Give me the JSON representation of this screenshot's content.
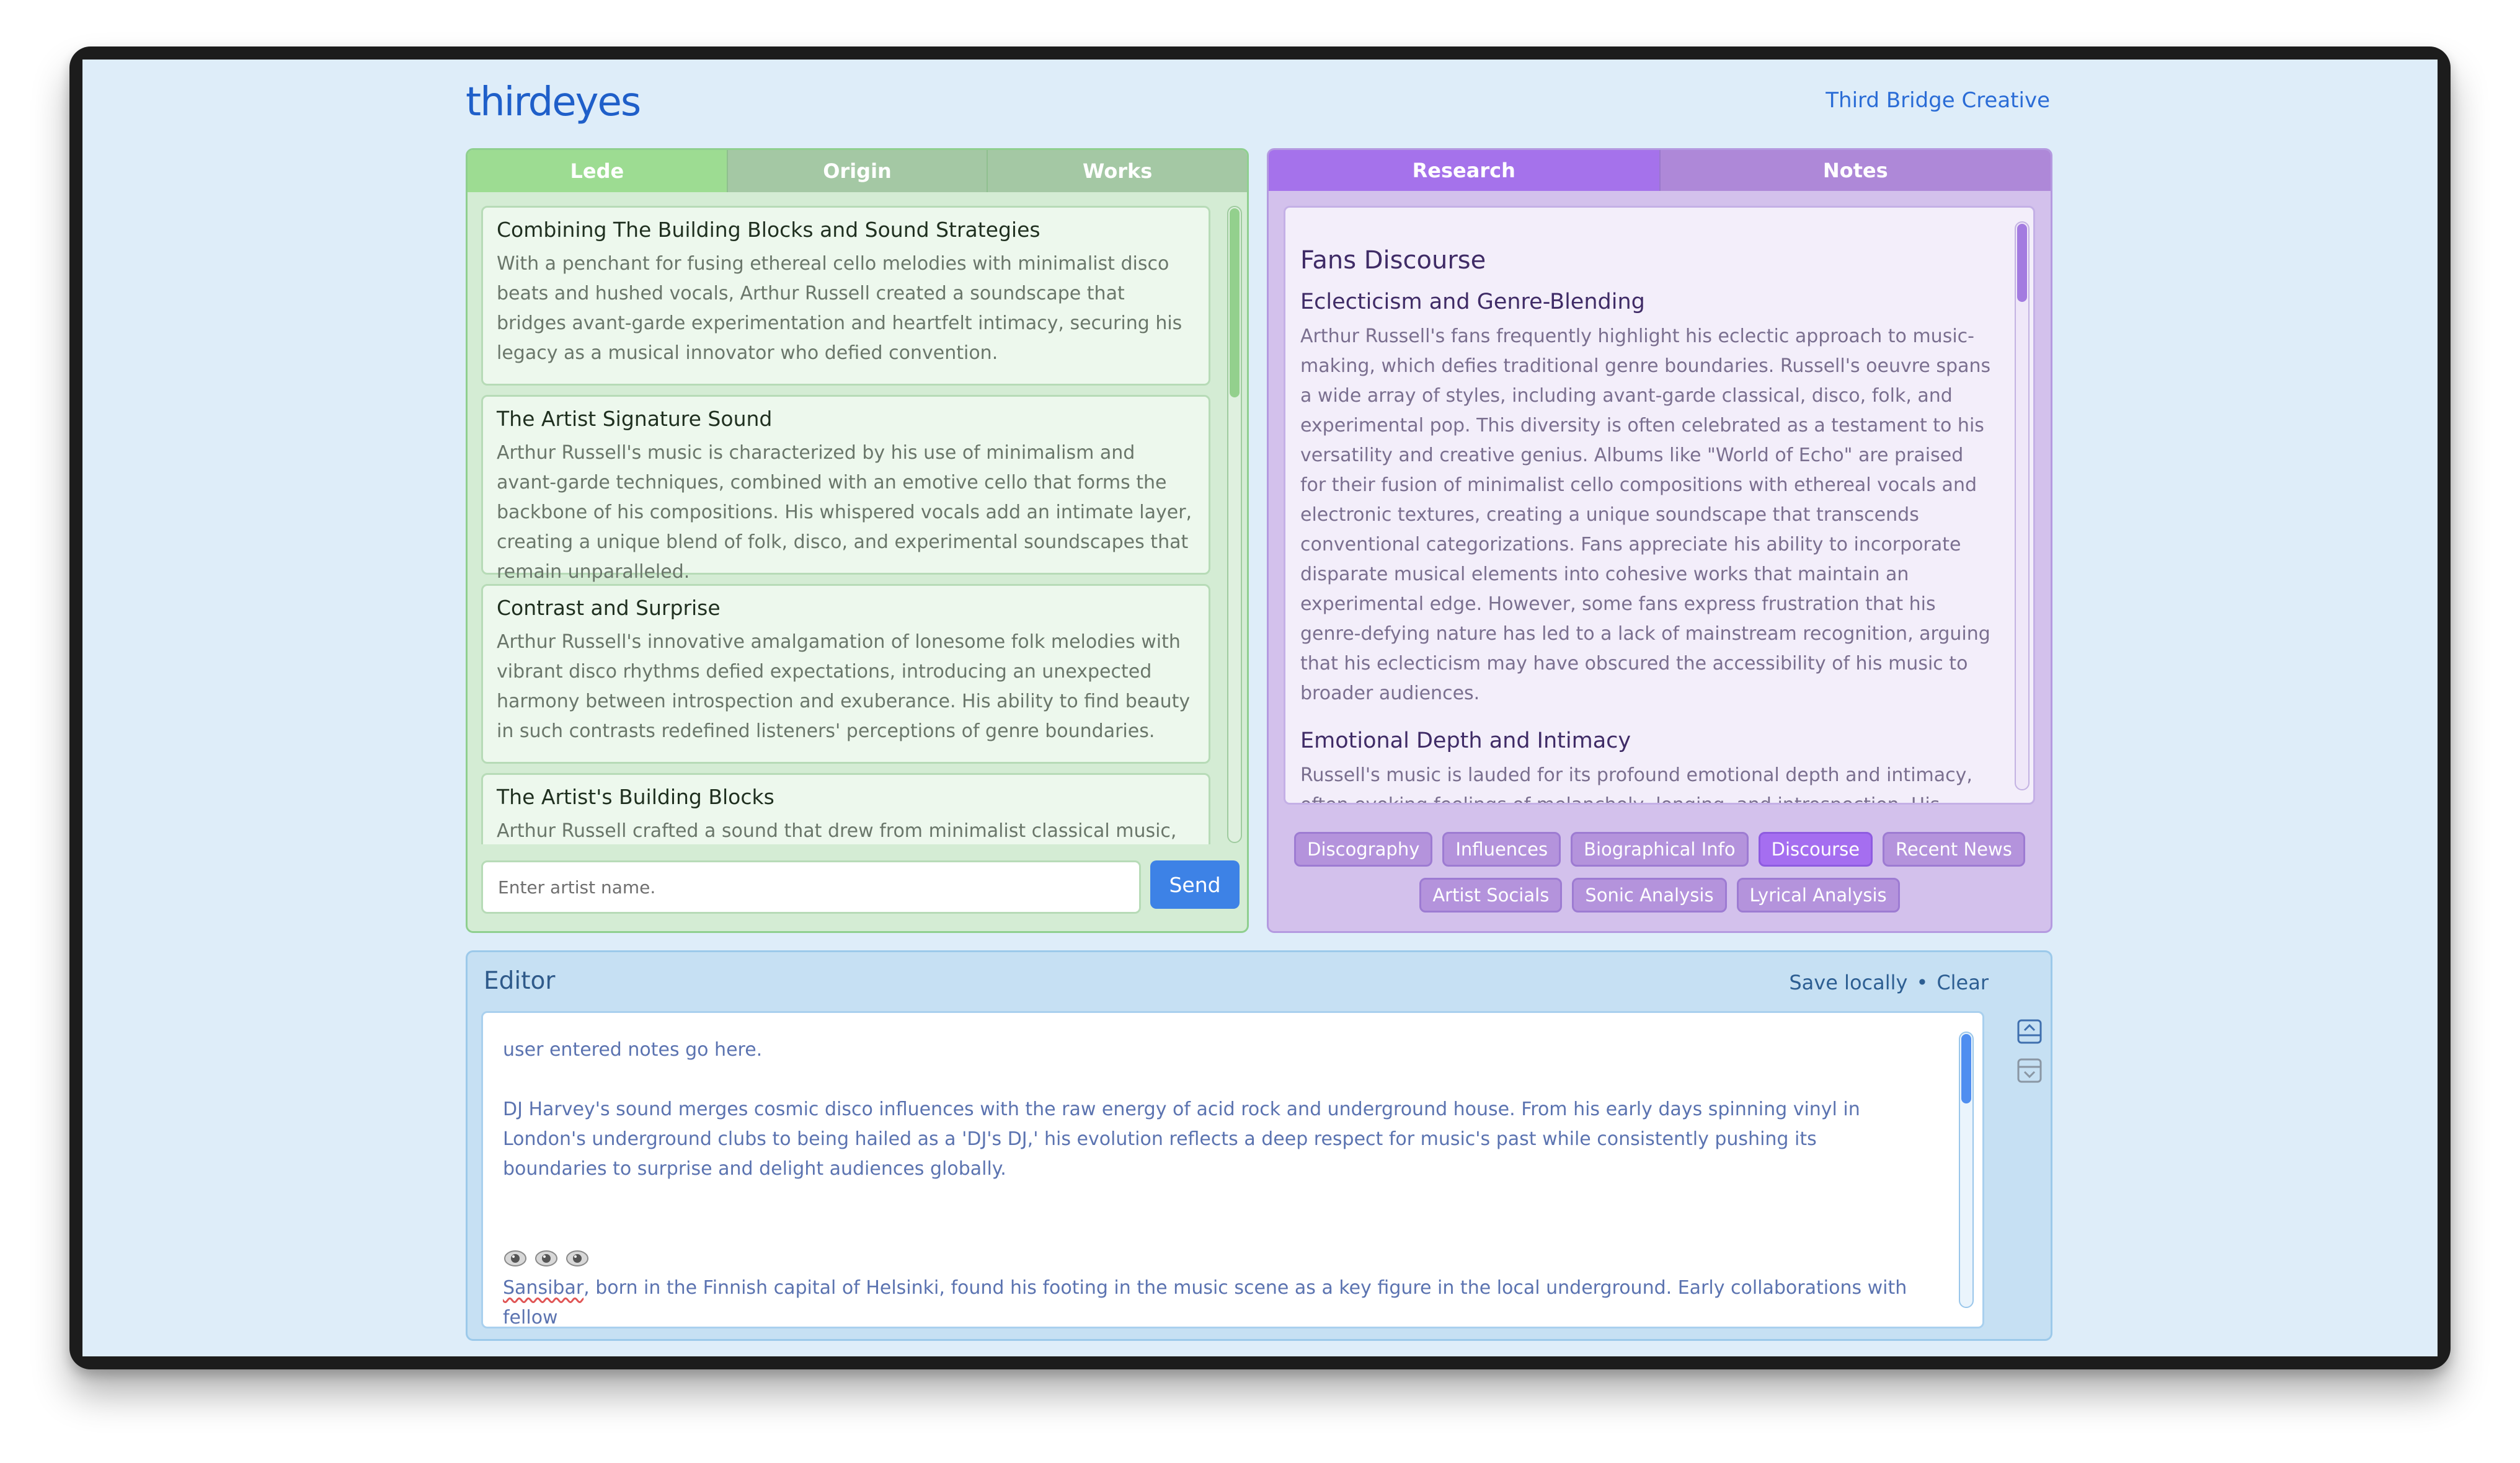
{
  "header": {
    "logo_text": "thirdeyes",
    "brand_link": "Third Bridge Creative"
  },
  "left_panel": {
    "tabs": [
      "Lede",
      "Origin",
      "Works"
    ],
    "active_tab": "Lede",
    "cards": [
      {
        "title": "Combining The Building Blocks and Sound Strategies",
        "body": "With a penchant for fusing ethereal cello melodies with minimalist disco beats and hushed vocals, Arthur Russell created a soundscape that bridges avant-garde experimentation and heartfelt intimacy, securing his legacy as a musical innovator who defied convention."
      },
      {
        "title": "The Artist Signature Sound",
        "body": "Arthur Russell's music is characterized by his use of minimalism and avant-garde techniques, combined with an emotive cello that forms the backbone of his compositions. His whispered vocals add an intimate layer, creating a unique blend of folk, disco, and experimental soundscapes that remain unparalleled."
      },
      {
        "title": "Contrast and Surprise",
        "body": "Arthur Russell's innovative amalgamation of lonesome folk melodies with vibrant disco rhythms defied expectations, introducing an unexpected harmony between introspection and exuberance. His ability to find beauty in such contrasts redefined listeners' perceptions of genre boundaries."
      },
      {
        "title": "The Artist's Building Blocks",
        "body": "Arthur Russell crafted a sound that drew from minimalist classical music,"
      }
    ],
    "input_placeholder": "Enter artist name.",
    "send_label": "Send"
  },
  "right_panel": {
    "tabs": [
      "Research",
      "Notes"
    ],
    "active_tab": "Research",
    "heading": "Fans Discourse",
    "sections": [
      {
        "title": "Eclecticism and Genre-Blending",
        "body": "Arthur Russell's fans frequently highlight his eclectic approach to music-making, which defies traditional genre boundaries. Russell's oeuvre spans a wide array of styles, including avant-garde classical, disco, folk, and experimental pop. This diversity is often celebrated as a testament to his versatility and creative genius. Albums like \"World of Echo\" are praised for their fusion of minimalist cello compositions with ethereal vocals and electronic textures, creating a unique soundscape that transcends conventional categorizations. Fans appreciate his ability to incorporate disparate musical elements into cohesive works that maintain an experimental edge. However, some fans express frustration that his genre-defying nature has led to a lack of mainstream recognition, arguing that his eclecticism may have obscured the accessibility of his music to broader audiences."
      },
      {
        "title": "Emotional Depth and Intimacy",
        "body": "Russell's music is lauded for its profound emotional depth and intimacy, often evoking feelings of melancholy, longing, and introspection. His vocal delivery is"
      }
    ],
    "chips_row1": [
      "Discography",
      "Influences",
      "Biographical Info",
      "Discourse",
      "Recent News"
    ],
    "chips_row2": [
      "Artist Socials",
      "Sonic Analysis",
      "Lyrical Analysis"
    ],
    "active_chip": "Discourse"
  },
  "editor": {
    "title": "Editor",
    "save_label": "Save locally",
    "separator": "•",
    "clear_label": "Clear",
    "line1": "user entered notes go here.",
    "paragraph": "DJ Harvey's sound merges cosmic disco influences with the raw energy of acid rock and underground house. From his early days spinning vinyl in London's underground clubs to being hailed as a 'DJ's DJ,' his evolution reflects a deep respect for music's past while consistently pushing its boundaries to surprise and delight audiences globally.",
    "last_word": "Sansibar",
    "last_rest": ", born in the Finnish capital of Helsinki, found his footing in the music scene as a key figure in the local underground. Early collaborations with fellow",
    "icons": [
      "collapse-up-icon",
      "expand-down-icon",
      "eye-icon"
    ]
  },
  "colors": {
    "left_accent": "#9ddc92",
    "right_accent": "#a572eb",
    "send_button": "#3d82e6",
    "editor_text": "#5b73b0"
  }
}
